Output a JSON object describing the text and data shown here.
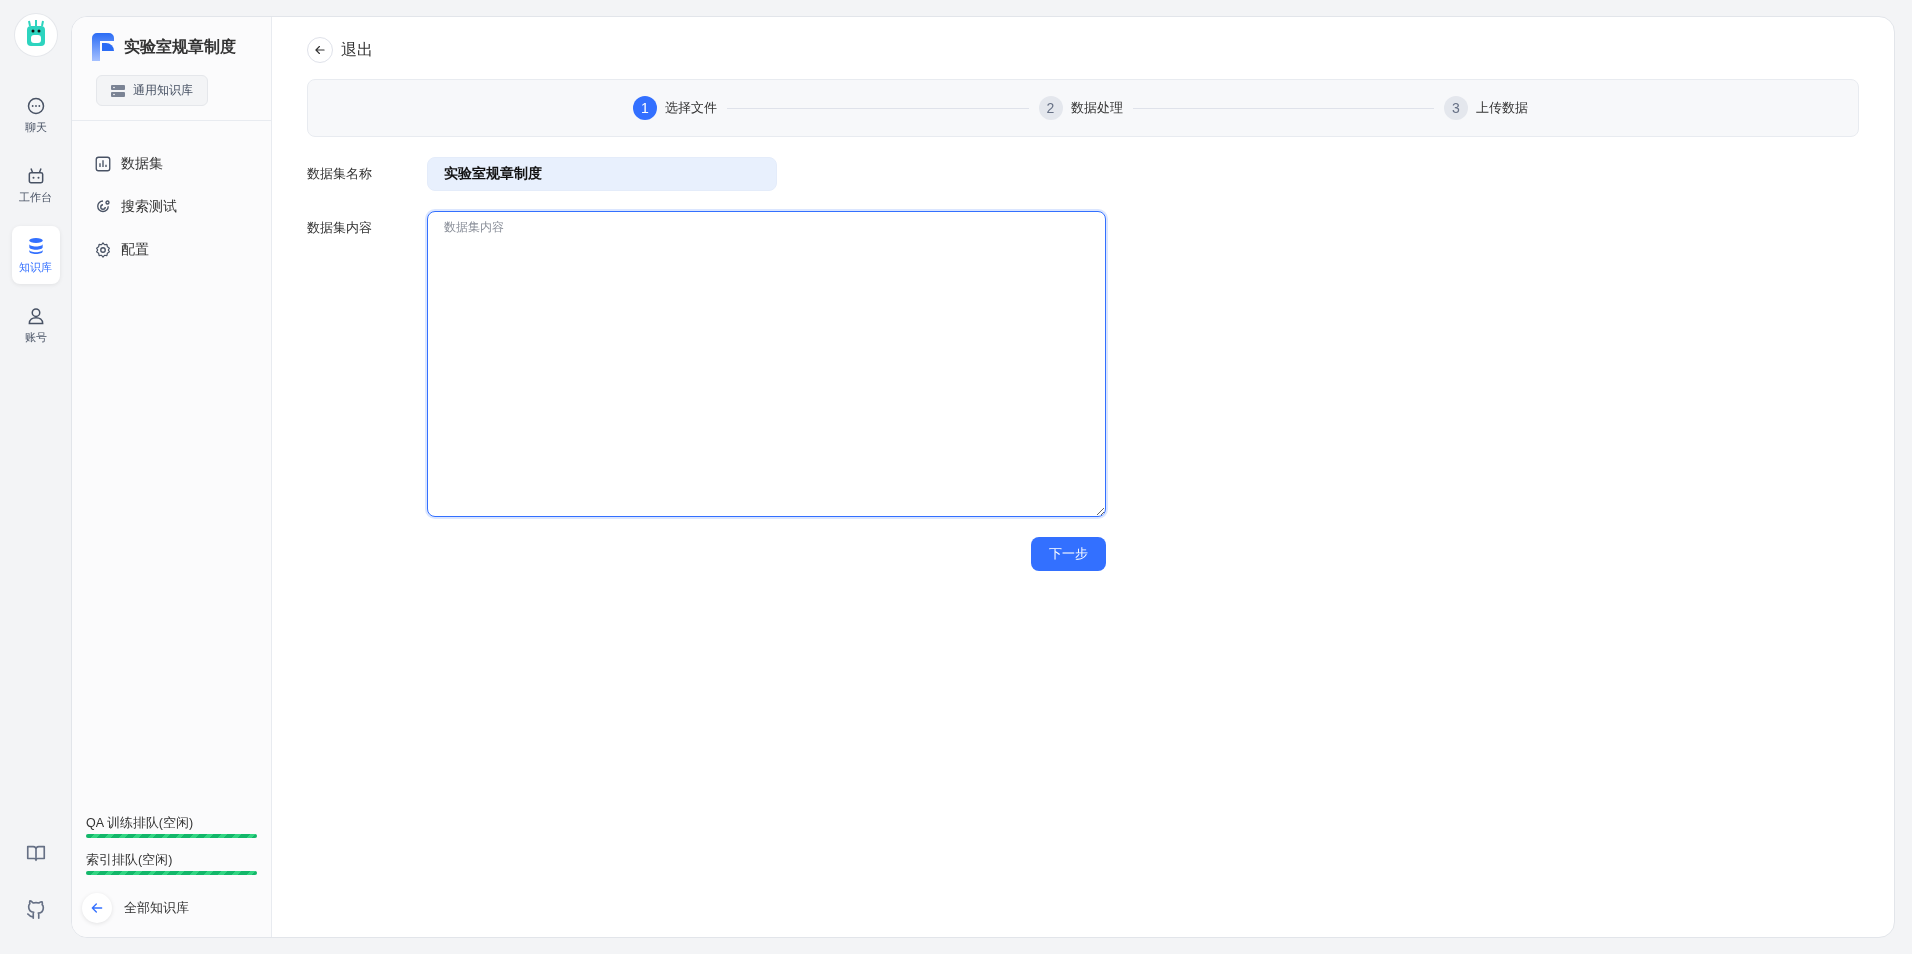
{
  "rail": {
    "items": [
      {
        "label": "聊天",
        "selected": false
      },
      {
        "label": "工作台",
        "selected": false
      },
      {
        "label": "知识库",
        "selected": true
      },
      {
        "label": "账号",
        "selected": false
      }
    ]
  },
  "sidebar": {
    "title": "实验室规章制度",
    "tag": "通用知识库",
    "items": [
      {
        "label": "数据集",
        "selected": false
      },
      {
        "label": "搜索测试",
        "selected": false
      },
      {
        "label": "配置",
        "selected": false
      }
    ],
    "queues": [
      {
        "label": "QA 训练排队(空闲)",
        "level": 1
      },
      {
        "label": "索引排队(空闲)",
        "level": 1
      }
    ],
    "back": "全部知识库"
  },
  "main": {
    "exit": "退出",
    "steps": [
      {
        "number": "1",
        "label": "选择文件",
        "selected": true
      },
      {
        "number": "2",
        "label": "数据处理",
        "selected": false
      },
      {
        "number": "3",
        "label": "上传数据",
        "selected": false
      }
    ],
    "name_label": "数据集名称",
    "name_value": "实验室规章制度",
    "content_label": "数据集内容",
    "content_placeholder": "数据集内容",
    "next": "下一步"
  }
}
